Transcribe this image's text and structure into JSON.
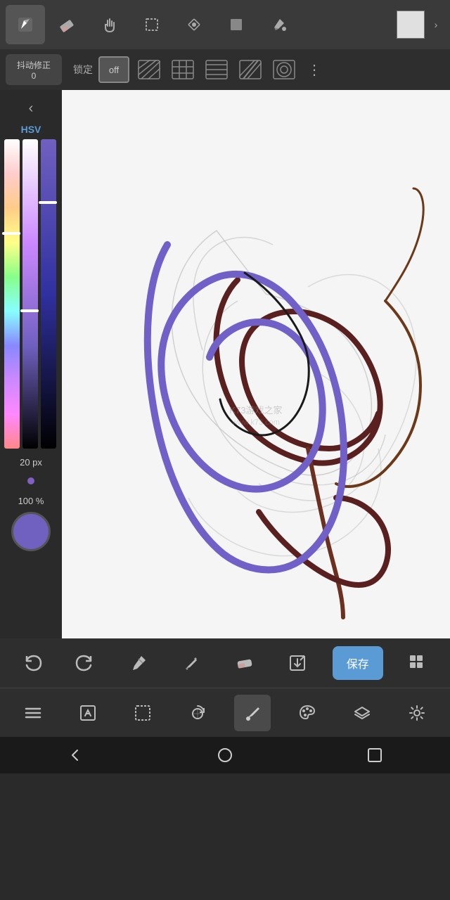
{
  "top_toolbar": {
    "tools": [
      {
        "id": "pen",
        "label": "✏️",
        "active": true,
        "name": "pen-tool"
      },
      {
        "id": "eraser",
        "label": "eraser",
        "active": false,
        "name": "eraser-tool"
      },
      {
        "id": "hand",
        "label": "hand",
        "active": false,
        "name": "hand-tool"
      },
      {
        "id": "rect-select",
        "label": "rect",
        "active": false,
        "name": "rect-select-tool"
      },
      {
        "id": "transform",
        "label": "transform",
        "active": false,
        "name": "transform-tool"
      },
      {
        "id": "rect-fill",
        "label": "rect-fill",
        "active": false,
        "name": "rect-fill-tool"
      },
      {
        "id": "fill",
        "label": "fill",
        "active": false,
        "name": "fill-tool"
      }
    ],
    "expand_label": "›"
  },
  "stabilizer_bar": {
    "stabilizer_label": "抖动修正",
    "stabilizer_value": "0",
    "lock_label": "锁定",
    "lock_off_label": "off",
    "more_label": "⋮"
  },
  "left_panel": {
    "collapse_label": "‹",
    "color_mode_label": "HSV",
    "size_label": "20 px",
    "opacity_label": "100 %"
  },
  "bottom_toolbar_1": {
    "undo_label": "↩",
    "redo_label": "↪",
    "eyedropper_label": "💉",
    "pencil_label": "✏",
    "eraser_label": "eraser",
    "export_label": "export",
    "save_label": "保存",
    "grid_label": "grid"
  },
  "bottom_toolbar_2": {
    "menu_label": "≡",
    "edit_label": "edit",
    "select_label": "select",
    "rotate_label": "rotate",
    "brush_label": "brush",
    "palette_label": "palette",
    "layers_label": "layers",
    "settings_label": "settings"
  },
  "nav_bar": {
    "back_label": "◁",
    "home_label": "○",
    "recent_label": "□"
  },
  "watermark": "K73游戏之家",
  "colors": {
    "accent": "#5b9bd5",
    "active_tool_bg": "#555555",
    "toolbar_bg": "#3a3a3a",
    "secondary_bg": "#2e2e2e",
    "canvas_bg": "#f5f5f5"
  }
}
